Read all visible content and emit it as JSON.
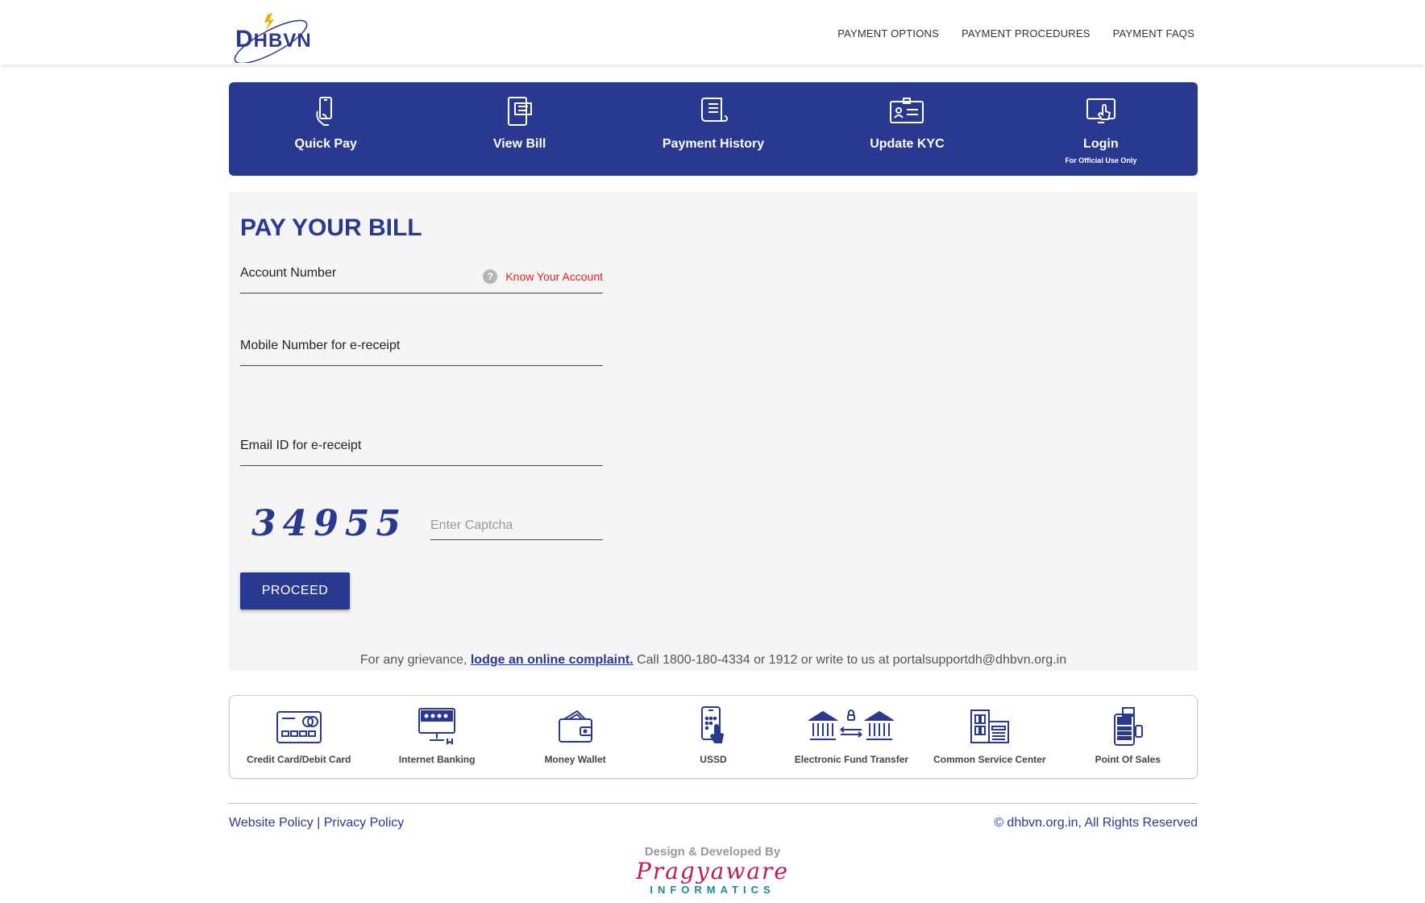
{
  "header": {
    "logo_text_big": "D",
    "logo_text_small": "HBVN",
    "nav": [
      "PAYMENT OPTIONS",
      "PAYMENT PROCEDURES",
      "PAYMENT FAQS"
    ]
  },
  "tabs": [
    {
      "label": "Quick Pay",
      "icon": "mobile-hand-icon",
      "sub": ""
    },
    {
      "label": "View Bill",
      "icon": "bill-screen-icon",
      "sub": ""
    },
    {
      "label": "Payment History",
      "icon": "receipt-scroll-icon",
      "sub": ""
    },
    {
      "label": "Update KYC",
      "icon": "id-card-icon",
      "sub": ""
    },
    {
      "label": "Login",
      "icon": "monitor-touch-icon",
      "sub": "For Official Use Only"
    }
  ],
  "form": {
    "title": "PAY YOUR BILL",
    "account_label": "Account Number",
    "help_glyph": "?",
    "know_account": "Know Your Account",
    "mobile_label": "Mobile Number for e-receipt",
    "email_label": "Email ID for e-receipt",
    "captcha_code": "34955",
    "captcha_placeholder": "Enter Captcha",
    "proceed": "PROCEED"
  },
  "grievance": {
    "prefix": "For any grievance, ",
    "link": "lodge an online complaint.",
    "suffix": " Call 1800-180-4334 or 1912 or write to us at portalsupportdh@dhbvn.org.in"
  },
  "payment_options": [
    {
      "label": "Credit Card/Debit Card",
      "icon": "credit-card-icon"
    },
    {
      "label": "Internet Banking",
      "icon": "internet-banking-icon"
    },
    {
      "label": "Money Wallet",
      "icon": "wallet-icon"
    },
    {
      "label": "USSD",
      "icon": "ussd-phone-icon"
    },
    {
      "label": "Electronic Fund Transfer",
      "icon": "bank-transfer-icon"
    },
    {
      "label": "Common Service Center",
      "icon": "service-center-icon"
    },
    {
      "label": "Point Of Sales",
      "icon": "pos-terminal-icon"
    }
  ],
  "footer": {
    "website_policy": "Website Policy",
    "separator": " | ",
    "privacy_policy": "Privacy Policy",
    "copyright": "© dhbvn.org.in, All Rights Reserved",
    "designed_by": "Design & Developed By",
    "brand": "Pragyaware",
    "brand_sub": "INFORMATICS"
  },
  "colors": {
    "primary": "#2a3990",
    "accent_red": "#e41e26",
    "panel_bg": "#f5f5f5"
  }
}
